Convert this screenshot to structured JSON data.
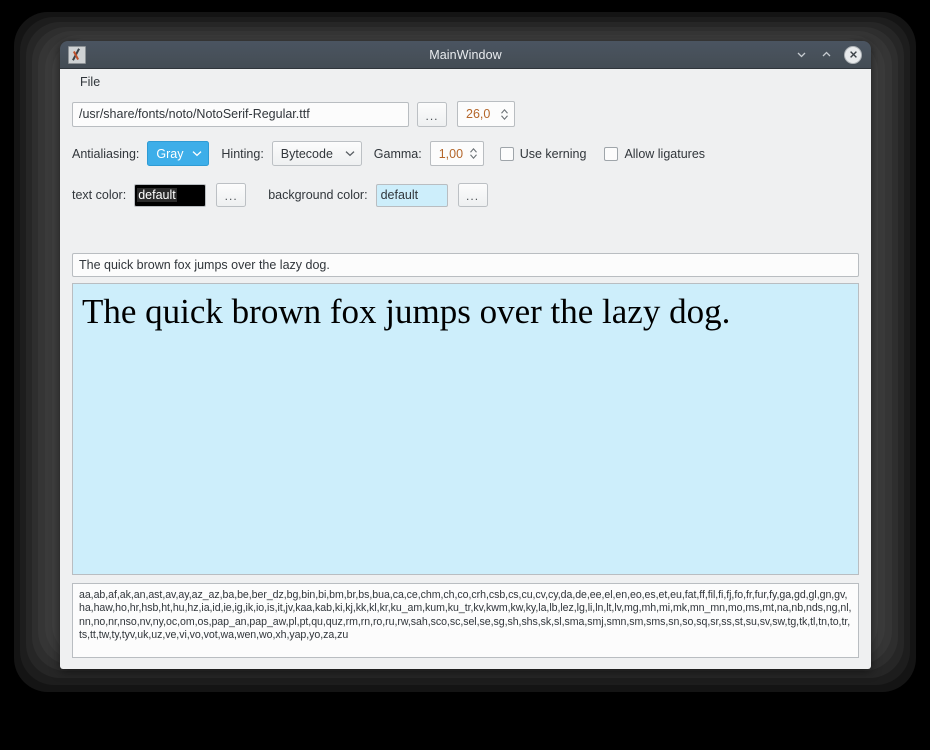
{
  "window": {
    "title": "MainWindow",
    "icon": "app-icon",
    "buttons": {
      "minimize": "minimize-icon",
      "maximize": "maximize-icon",
      "close": "close-icon"
    }
  },
  "menubar": {
    "items": [
      {
        "label": "File"
      }
    ]
  },
  "font_row": {
    "path_value": "/usr/share/fonts/noto/NotoSerif-Regular.ttf",
    "browse_label": "...",
    "size_value": "26,0"
  },
  "options_row": {
    "antialiasing_label": "Antialiasing:",
    "antialiasing_value": "Gray",
    "hinting_label": "Hinting:",
    "hinting_value": "Bytecode",
    "gamma_label": "Gamma:",
    "gamma_value": "1,00",
    "use_kerning_label": "Use kerning",
    "use_kerning_checked": false,
    "allow_ligatures_label": "Allow ligatures",
    "allow_ligatures_checked": false
  },
  "colors_row": {
    "text_color_label": "text color:",
    "text_color_value": "default",
    "text_color_swatch": "#000000",
    "text_color_browse": "...",
    "background_color_label": "background color:",
    "background_color_value": "default",
    "background_color_swatch": "#cdeefb",
    "background_color_browse": "..."
  },
  "sample": {
    "input_value": "The quick brown fox jumps over the lazy dog.",
    "preview_text": "The quick brown fox jumps over the lazy dog."
  },
  "features": {
    "text": "aa,ab,af,ak,an,ast,av,ay,az_az,ba,be,ber_dz,bg,bin,bi,bm,br,bs,bua,ca,ce,chm,ch,co,crh,csb,cs,cu,cv,cy,da,de,ee,el,en,eo,es,et,eu,fat,ff,fil,fi,fj,fo,fr,fur,fy,ga,gd,gl,gn,gv,ha,haw,ho,hr,hsb,ht,hu,hz,ia,id,ie,ig,ik,io,is,it,jv,kaa,kab,ki,kj,kk,kl,kr,ku_am,kum,ku_tr,kv,kwm,kw,ky,la,lb,lez,lg,li,ln,lt,lv,mg,mh,mi,mk,mn_mn,mo,ms,mt,na,nb,nds,ng,nl,nn,no,nr,nso,nv,ny,oc,om,os,pap_an,pap_aw,pl,pt,qu,quz,rm,rn,ro,ru,rw,sah,sco,sc,sel,se,sg,sh,shs,sk,sl,sma,smj,smn,sm,sms,sn,so,sq,sr,ss,st,su,sv,sw,tg,tk,tl,tn,to,tr,ts,tt,tw,ty,tyv,uk,uz,ve,vi,vo,vot,wa,wen,wo,xh,yap,yo,za,zu"
  },
  "theme": {
    "accent": "#3daee9",
    "window_bg": "#eff0f1",
    "titlebar_bg": "#475059",
    "preview_bg": "#cdeefb",
    "spin_text": "#b4662a"
  }
}
